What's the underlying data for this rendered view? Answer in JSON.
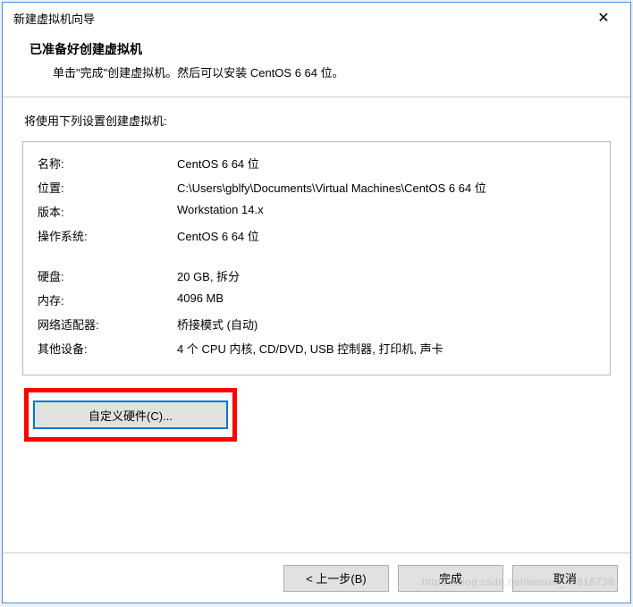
{
  "window": {
    "title": "新建虚拟机向导"
  },
  "header": {
    "title": "已准备好创建虚拟机",
    "subtitle": "单击\"完成\"创建虚拟机。然后可以安装 CentOS 6 64 位。"
  },
  "summary": {
    "intro": "将使用下列设置创建虚拟机:",
    "rows1": [
      {
        "key": "名称:",
        "val": "CentOS 6 64 位"
      },
      {
        "key": "位置:",
        "val": "C:\\Users\\gblfy\\Documents\\Virtual Machines\\CentOS 6 64 位"
      },
      {
        "key": "版本:",
        "val": "Workstation 14.x"
      },
      {
        "key": "操作系统:",
        "val": "CentOS 6 64 位"
      }
    ],
    "rows2": [
      {
        "key": "硬盘:",
        "val": "20 GB, 拆分"
      },
      {
        "key": "内存:",
        "val": "4096 MB"
      },
      {
        "key": "网络适配器:",
        "val": "桥接模式 (自动)"
      },
      {
        "key": "其他设备:",
        "val": "4 个 CPU 内核, CD/DVD, USB 控制器, 打印机, 声卡"
      }
    ]
  },
  "buttons": {
    "customize": "自定义硬件(C)...",
    "back": "< 上一步(B)",
    "finish": "完成",
    "cancel": "取消"
  },
  "watermark": "https://blog.csdn.net/weixin_40816738"
}
